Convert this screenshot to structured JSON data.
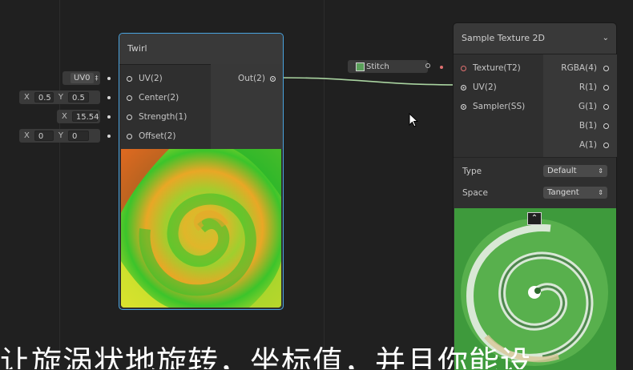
{
  "twirl_node": {
    "title": "Twirl",
    "inputs": [
      {
        "label": "UV(2)"
      },
      {
        "label": "Center(2)"
      },
      {
        "label": "Strength(1)"
      },
      {
        "label": "Offset(2)"
      }
    ],
    "output": "Out(2)",
    "preview_icon": "twirl-rgb-preview"
  },
  "twirl_fields": {
    "uv_channel": "UV0",
    "uv_arrows": "‡",
    "center_x_label": "X",
    "center_x": "0.5",
    "center_y_label": "Y",
    "center_y": "0.5",
    "strength_x_label": "X",
    "strength_x": "15.54",
    "offset_x_label": "X",
    "offset_x": "0",
    "offset_y_label": "Y",
    "offset_y": "0"
  },
  "texture_field": {
    "value": "Stitch"
  },
  "sample_node": {
    "title": "Sample Texture 2D",
    "inputs": [
      {
        "label": "Texture(T2)"
      },
      {
        "label": "UV(2)"
      },
      {
        "label": "Sampler(SS)"
      }
    ],
    "outputs": [
      {
        "label": "RGBA(4)"
      },
      {
        "label": "R(1)"
      },
      {
        "label": "G(1)"
      },
      {
        "label": "B(1)"
      },
      {
        "label": "A(1)"
      }
    ],
    "type_label": "Type",
    "type_value": "Default",
    "space_label": "Space",
    "space_value": "Tangent",
    "preview_icon": "swirl-texture-preview"
  },
  "subtitle": {
    "text": "让旋涡状地旋转，坐标值，并且你能设"
  },
  "colors": {
    "selection": "#4aa3df",
    "edge_green": "#a9d3a0"
  }
}
